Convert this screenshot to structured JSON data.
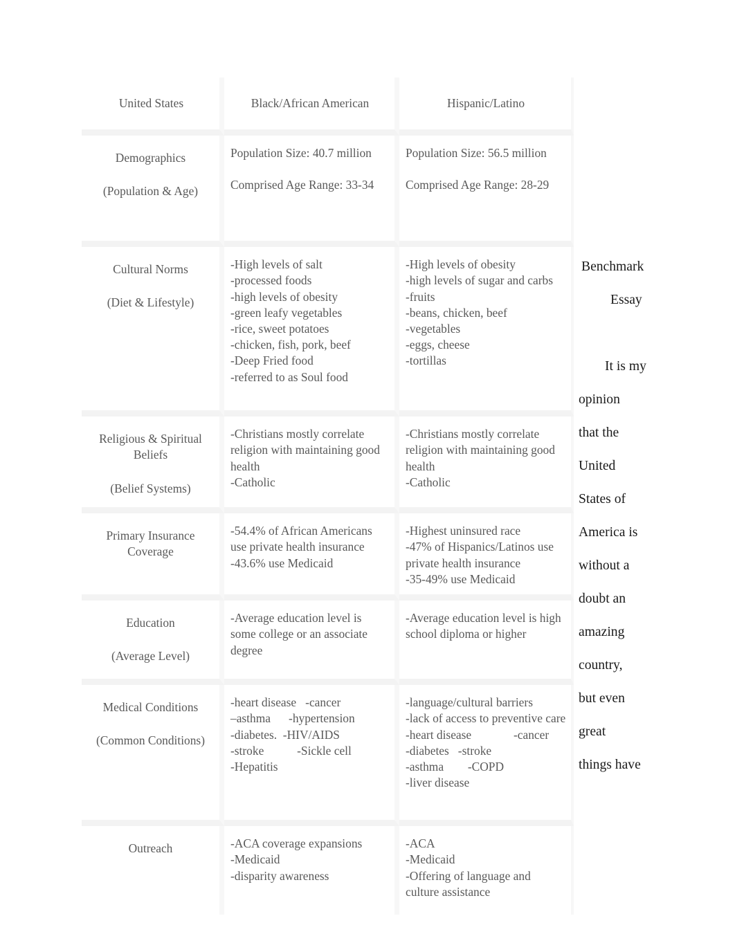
{
  "document": {
    "type": "comparison-table-with-essay-text"
  },
  "table": {
    "columns": [
      {
        "id": "united-states",
        "label": "United States"
      },
      {
        "id": "black-african-american",
        "label": "Black/African American"
      },
      {
        "id": "hispanic-latino",
        "label": "Hispanic/Latino"
      }
    ],
    "rows": [
      {
        "id": "demographics",
        "label_main": "Demographics",
        "label_sub": "(Population & Age)",
        "black": [
          "Population Size: 40.7 million",
          "Comprised Age Range: 33-34"
        ],
        "hispanic": [
          "Population Size: 56.5 million",
          "Comprised Age Range: 28-29"
        ]
      },
      {
        "id": "cultural-norms",
        "label_main": "Cultural Norms",
        "label_sub": "(Diet & Lifestyle)",
        "black": [
          "-High levels of salt\n-processed foods\n-high levels of obesity\n-green leafy vegetables\n-rice, sweet potatoes\n-chicken, fish, pork, beef\n-Deep Fried food\n-referred to as Soul food"
        ],
        "hispanic": [
          "-High levels of obesity\n-high levels of sugar and carbs\n-fruits\n-beans, chicken, beef\n-vegetables\n-eggs, cheese\n-tortillas"
        ]
      },
      {
        "id": "religious-spiritual-beliefs",
        "label_main": "Religious & Spiritual Beliefs",
        "label_sub": "(Belief Systems)",
        "black": [
          "-Christians mostly correlate religion with maintaining good health\n-Catholic"
        ],
        "hispanic": [
          "-Christians mostly correlate religion with maintaining good health\n-Catholic"
        ]
      },
      {
        "id": "primary-insurance-coverage",
        "label_main": "Primary Insurance Coverage",
        "label_sub": "",
        "black": [
          "-54.4% of African Americans use private health insurance    -43.6% use Medicaid"
        ],
        "hispanic": [
          "-Highest uninsured race\n-47% of Hispanics/Latinos use private health insurance\n-35-49% use Medicaid"
        ]
      },
      {
        "id": "education",
        "label_main": "Education",
        "label_sub": "(Average Level)",
        "black": [
          "-Average education level is some college or an associate degree"
        ],
        "hispanic": [
          "-Average education level is high school diploma or higher"
        ]
      },
      {
        "id": "medical-conditions",
        "label_main": "Medical Conditions",
        "label_sub": "(Common Conditions)",
        "black": [
          "-heart disease   -cancer\n–asthma      -hypertension\n-diabetes.  -HIV/AIDS\n-stroke           -Sickle cell\n-Hepatitis"
        ],
        "hispanic": [
          "-language/cultural barriers\n-lack of access to preventive care    -heart disease              -cancer\n-diabetes   -stroke\n-asthma        -COPD\n-liver disease"
        ]
      },
      {
        "id": "outreach",
        "label_main": "Outreach",
        "label_sub": "",
        "black": [
          "-ACA coverage expansions\n-Medicaid\n-disparity awareness"
        ],
        "hispanic": [
          "-ACA\n-Medicaid\n-Offering of language and culture assistance"
        ]
      }
    ]
  },
  "essay": {
    "title_line_1": "Benchmark",
    "title_line_2": "Essay",
    "body_lines": [
      "It is my",
      "opinion",
      "that the",
      "United",
      "States of",
      "America is",
      "without a",
      "doubt an",
      "amazing",
      "country,",
      "but even",
      "great",
      "things have"
    ]
  },
  "colors": {
    "table_text": "#595959",
    "essay_text": "#1a1a1a",
    "page_background": "#ffffff",
    "cell_gap": "#f3f3f3"
  }
}
